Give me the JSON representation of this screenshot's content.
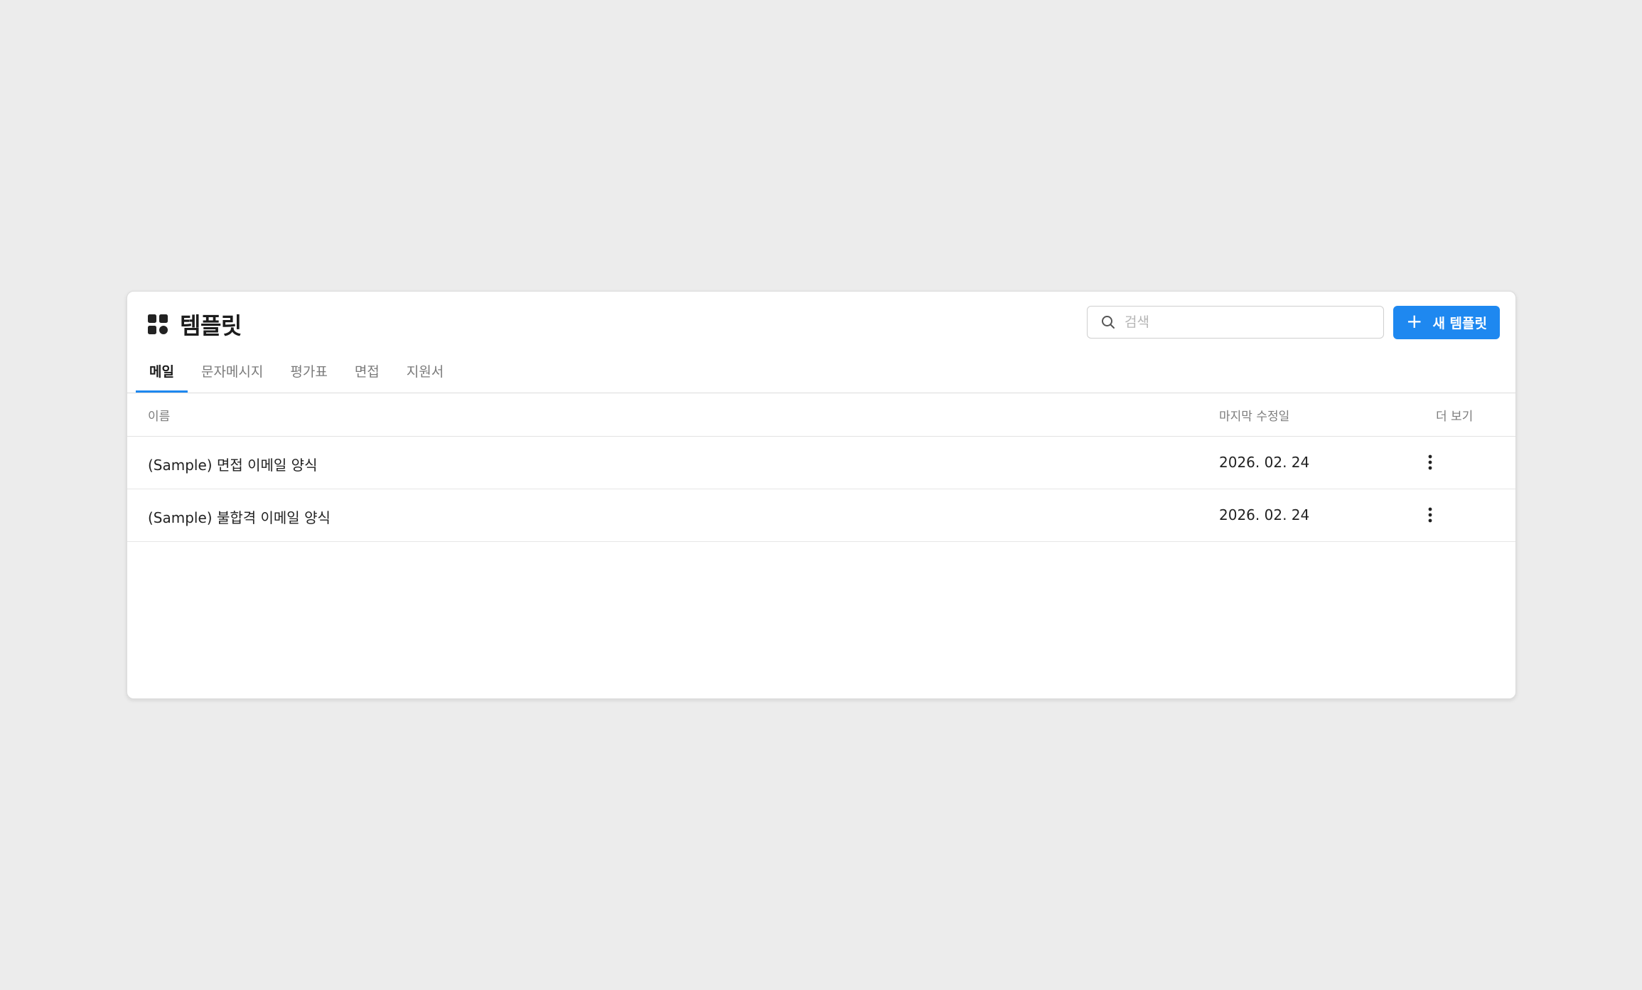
{
  "header": {
    "title": "템플릿",
    "search_placeholder": "검색",
    "new_button_label": "새 템플릿"
  },
  "tabs": [
    {
      "label": "메일",
      "active": true
    },
    {
      "label": "문자메시지",
      "active": false
    },
    {
      "label": "평가표",
      "active": false
    },
    {
      "label": "면접",
      "active": false
    },
    {
      "label": "지원서",
      "active": false
    }
  ],
  "table": {
    "columns": {
      "name": "이름",
      "last_modified": "마지막 수정일",
      "more": "더 보기"
    },
    "rows": [
      {
        "name": "(Sample) 면접 이메일 양식",
        "last_modified": "2026. 02. 24"
      },
      {
        "name": "(Sample) 불합격 이메일 양식",
        "last_modified": "2026. 02. 24"
      }
    ]
  },
  "colors": {
    "accent": "#1e88f0",
    "background": "#ececec",
    "panel": "#ffffff"
  },
  "icons": {
    "title": "grid-icon",
    "search": "search-icon",
    "add": "plus-icon",
    "row_menu": "more-vertical-icon"
  }
}
